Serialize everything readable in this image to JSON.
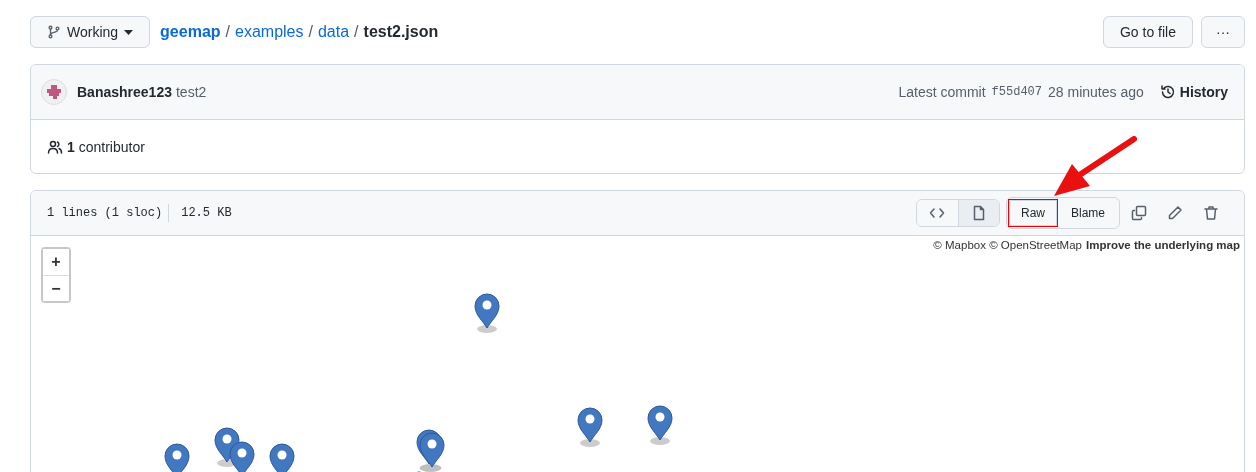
{
  "branch": {
    "label": "Working"
  },
  "breadcrumb": [
    {
      "label": "geemap",
      "kind": "repo"
    },
    {
      "label": "examples",
      "kind": "dir"
    },
    {
      "label": "data",
      "kind": "dir"
    },
    {
      "label": "test2.json",
      "kind": "file"
    }
  ],
  "separator": "/",
  "header_buttons": [
    {
      "label": "Go to file",
      "kind": "text"
    },
    {
      "label": "···",
      "kind": "more"
    }
  ],
  "commit": {
    "author": "Banashree123",
    "message": "test2",
    "prefix": "Latest commit",
    "sha": "f55d407",
    "time": "28 minutes ago",
    "history": "History"
  },
  "contributors": {
    "count": "1",
    "label": "contributor"
  },
  "file": {
    "lines": "1 lines (1 sloc)",
    "size": "12.5 KB",
    "view_toggle": [
      {
        "kind": "code",
        "selected": false
      },
      {
        "kind": "preview",
        "selected": true
      }
    ],
    "buttons": [
      {
        "label": "Raw",
        "highlighted": true
      },
      {
        "label": "Blame",
        "highlighted": false
      }
    ]
  },
  "map": {
    "zoom_in": "+",
    "zoom_out": "−",
    "attribution": "© Mapbox © OpenStreetMap",
    "improve_link": "Improve the underlying map"
  }
}
